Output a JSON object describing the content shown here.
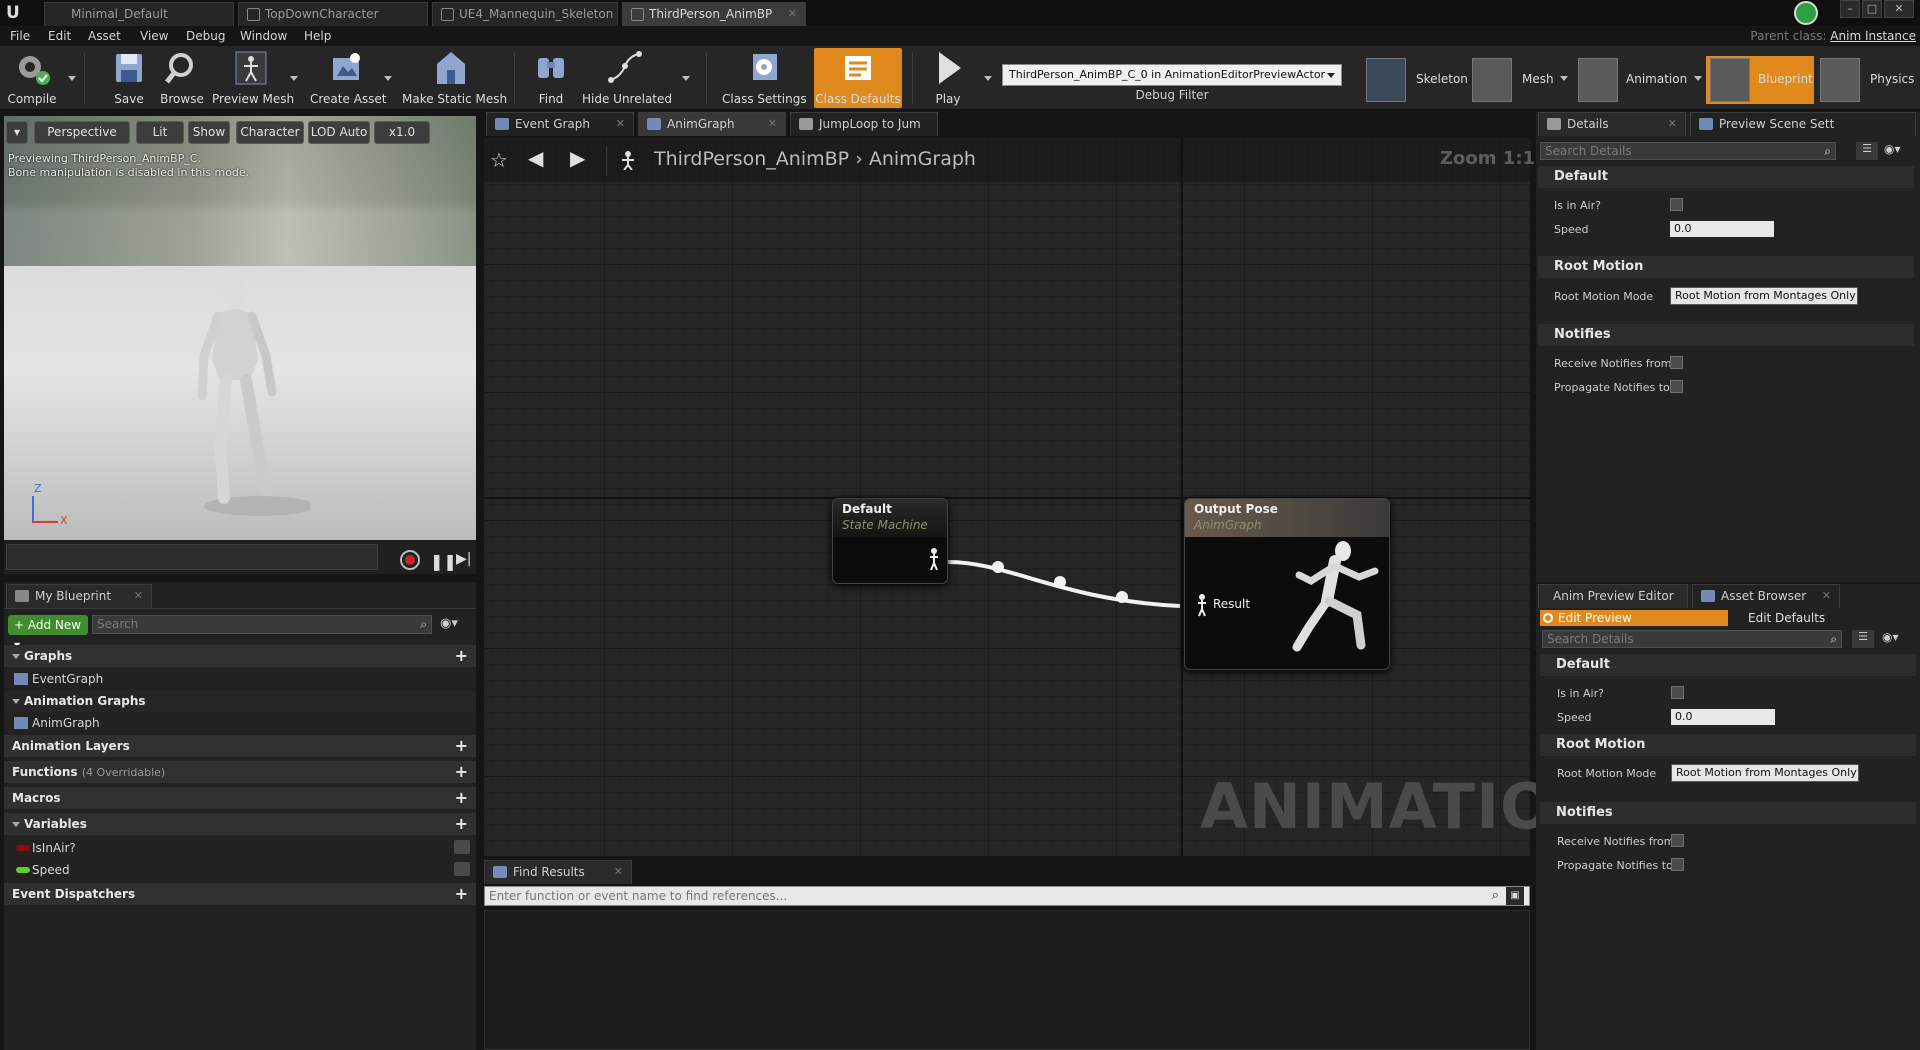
{
  "doc_tabs": [
    "Minimal_Default",
    "TopDownCharacter",
    "UE4_Mannequin_Skeleton",
    "ThirdPerson_AnimBP"
  ],
  "menu": [
    "File",
    "Edit",
    "Asset",
    "View",
    "Debug",
    "Window",
    "Help"
  ],
  "parent_class": {
    "label": "Parent class:",
    "value": "Anim Instance"
  },
  "toolbar": {
    "compile": "Compile",
    "save": "Save",
    "browse": "Browse",
    "preview_mesh": "Preview Mesh",
    "create_asset": "Create Asset",
    "make_static_mesh": "Make Static Mesh",
    "find": "Find",
    "hide_unrelated": "Hide Unrelated",
    "class_settings": "Class Settings",
    "class_defaults": "Class Defaults",
    "play": "Play",
    "debug_filter_value": "ThirdPerson_AnimBP_C_0 in AnimationEditorPreviewActor",
    "debug_filter_label": "Debug Filter"
  },
  "modes": [
    "Skeleton",
    "Mesh",
    "Animation",
    "Blueprint",
    "Physics"
  ],
  "viewport": {
    "buttons": [
      "Perspective",
      "Lit",
      "Show",
      "Character",
      "LOD Auto",
      "x1.0"
    ],
    "info_line1": "Previewing ThirdPerson_AnimBP_C.",
    "info_line2": "Bone manipulation is disabled in this mode.",
    "axis_z": "Z",
    "axis_x": "X"
  },
  "my_blueprint": {
    "tab": "My Blueprint",
    "add_new": "Add New",
    "search_placeholder": "Search",
    "graphs": "Graphs",
    "event_graph": "EventGraph",
    "animation_graphs": "Animation Graphs",
    "anim_graph": "AnimGraph",
    "animation_layers": "Animation Layers",
    "functions": "Functions",
    "functions_count": "(4 Overridable)",
    "macros": "Macros",
    "variables": "Variables",
    "var1": "IsInAir?",
    "var2": "Speed",
    "event_dispatchers": "Event Dispatchers",
    "var_colors": {
      "IsInAir?": "#8f0b0b",
      "Speed": "#5fce2a"
    }
  },
  "graph_tabs": [
    "Event Graph",
    "AnimGraph",
    "JumpLoop to Jum"
  ],
  "graph": {
    "crumb_root": "ThirdPerson_AnimBP",
    "crumb_leaf": "AnimGraph",
    "zoom": "Zoom 1:1",
    "watermark": "ANIMATION",
    "node1_title": "Default",
    "node1_sub": "State Machine",
    "node2_title": "Output Pose",
    "node2_sub": "AnimGraph",
    "node2_pin": "Result"
  },
  "find": {
    "tab": "Find Results",
    "placeholder": "Enter function or event name to find references..."
  },
  "details_top": {
    "tabs": [
      "Details",
      "Preview Scene Sett"
    ],
    "search": "Search Details",
    "default": "Default",
    "is_in_air": "Is in Air?",
    "speed": "Speed",
    "speed_value": "0.0",
    "root_motion": "Root Motion",
    "root_motion_mode": "Root Motion Mode",
    "root_motion_value": "Root Motion from Montages Only",
    "notifies": "Notifies",
    "receive_notifies": "Receive Notifies from",
    "propagate_notifies": "Propagate Notifies to"
  },
  "details_bottom": {
    "tabs": [
      "Anim Preview Editor",
      "Asset Browser"
    ],
    "edit_preview": "Edit Preview",
    "edit_defaults": "Edit Defaults",
    "search": "Search Details",
    "default": "Default",
    "is_in_air": "Is in Air?",
    "speed": "Speed",
    "speed_value": "0.0",
    "root_motion": "Root Motion",
    "root_motion_mode": "Root Motion Mode",
    "root_motion_value": "Root Motion from Montages Only",
    "notifies": "Notifies",
    "receive_notifies": "Receive Notifies from",
    "propagate_notifies": "Propagate Notifies to"
  },
  "colors": {
    "accent": "#e08a1d",
    "add_new": "#3f8d2d"
  }
}
